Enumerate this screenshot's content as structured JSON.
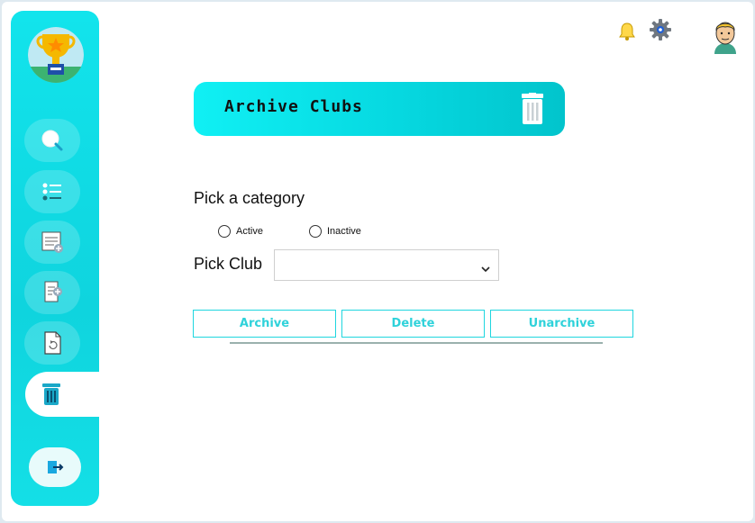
{
  "header": {
    "title": "Archive Clubs"
  },
  "category": {
    "label": "Pick a category",
    "options": [
      "Active",
      "Inactive"
    ],
    "selected": null
  },
  "club": {
    "label": "Pick Club",
    "value": ""
  },
  "actions": {
    "archive": "Archive",
    "delete": "Delete",
    "unarchive": "Unarchive"
  },
  "sidebar": {
    "items": [
      {
        "icon": "search-icon"
      },
      {
        "icon": "list-icon"
      },
      {
        "icon": "add-note-icon"
      },
      {
        "icon": "add-document-icon"
      },
      {
        "icon": "refresh-document-icon"
      },
      {
        "icon": "trash-icon",
        "active": true
      },
      {
        "icon": "logout-icon"
      }
    ]
  },
  "colors": {
    "accent": "#0fd8e0",
    "button_text": "#2fd2da"
  }
}
